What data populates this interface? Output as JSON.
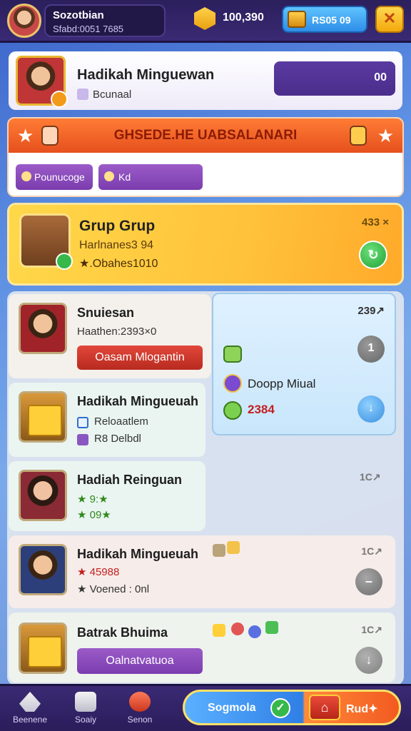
{
  "header": {
    "profile_name": "Sozotbian",
    "profile_sub": "Sfabd:0051 7685",
    "gold": "100,390",
    "gems_label": "RS05 09",
    "close_icon": "close-icon"
  },
  "player": {
    "name": "Hadikah Minguewan",
    "sub": "Bcunaal",
    "pill_value": "00"
  },
  "event": {
    "title": "GHSEDE.HE UABSALANARI",
    "chip1": "Pounucoge",
    "chip2": "Kd"
  },
  "group": {
    "title": "Grup Grup",
    "sub": "Harlnanes3 94",
    "stat": "★.Obahes1010",
    "corner": "433 ×",
    "go_symbol": "↻"
  },
  "popup": {
    "meta": "239↗",
    "name": "Doopp Miual",
    "value": "2384",
    "c1": "1",
    "c2": "↓"
  },
  "rows": [
    {
      "name": "Snuiesan",
      "line1": "Haathen:2393×0",
      "button": "Oasam Mlogantin"
    },
    {
      "name": "Hadikah Mingueuah",
      "line1": "Reloaatlem",
      "line2": "R8 Delbdl"
    },
    {
      "name": "Hadiah Reinguan",
      "line1": "★ 9:★",
      "line2": "★ 09★",
      "meta": "1C↗"
    },
    {
      "name": "Hadikah Mingueuah",
      "line1": "★ 45988",
      "line2": "★ Voened : 0nl",
      "meta": "1C↗",
      "circle": "–"
    },
    {
      "name": "Batrak Bhuima",
      "button": "Oalnatvatuoa",
      "meta": "1C↗",
      "circle": "↓"
    }
  ],
  "nav": [
    {
      "label": "Beenene",
      "icon": "rocket-icon"
    },
    {
      "label": "Soaiy",
      "icon": "dice-icon"
    },
    {
      "label": "Senon",
      "icon": "potion-icon"
    }
  ],
  "cta": {
    "left_label": "Sogmola",
    "right_label": "Rud✦"
  }
}
